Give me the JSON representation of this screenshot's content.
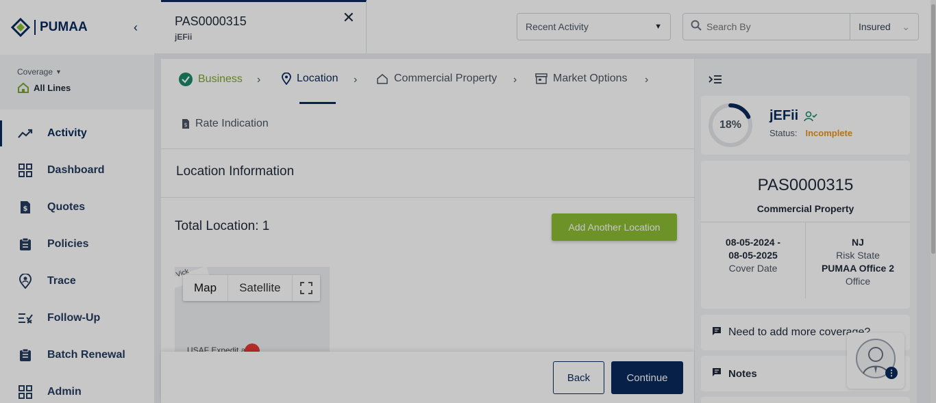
{
  "brand": {
    "name": "PUMAA"
  },
  "coverage": {
    "label": "Coverage",
    "value": "All Lines"
  },
  "nav": [
    {
      "label": "Activity",
      "icon": "trend-icon"
    },
    {
      "label": "Dashboard",
      "icon": "grid-icon"
    },
    {
      "label": "Quotes",
      "icon": "file-dollar-icon"
    },
    {
      "label": "Policies",
      "icon": "clipboard-icon"
    },
    {
      "label": "Trace",
      "icon": "location-person-icon"
    },
    {
      "label": "Follow-Up",
      "icon": "checklist-icon"
    },
    {
      "label": "Batch Renewal",
      "icon": "clipboard-list-icon"
    },
    {
      "label": "Admin",
      "icon": "grid-icon"
    }
  ],
  "tab": {
    "title": "PAS0000315",
    "subtitle": "jEFii"
  },
  "recent": {
    "label": "Recent Activity"
  },
  "search": {
    "placeholder": "Search By",
    "filter": "Insured"
  },
  "steps": {
    "business": "Business",
    "location": "Location",
    "commercial_property": "Commercial Property",
    "market_options": "Market Options",
    "rate_indication": "Rate Indication"
  },
  "main": {
    "section_title": "Location Information",
    "total_location": "Total Location: 1",
    "add_location": "Add Another Location"
  },
  "map": {
    "map_label": "Map",
    "satellite_label": "Satellite",
    "road_label": "Vick",
    "poi_label": "USAF Expedit        ary"
  },
  "footer": {
    "back": "Back",
    "continue": "Continue"
  },
  "status": {
    "name": "jEFii",
    "percent": "18%",
    "progress": 0.18,
    "status_label": "Status:",
    "status_value": "Incomplete"
  },
  "policy": {
    "number": "PAS0000315",
    "line": "Commercial Property",
    "date_line1": "08-05-2024 -",
    "date_line2": "08-05-2025",
    "date_label": "Cover Date",
    "state": "NJ",
    "state_label": "Risk State",
    "office": "PUMAA Office 2",
    "office_label": "Office"
  },
  "panel": {
    "coverage_prompt": "Need to add more coverage?",
    "notes": "Notes"
  },
  "colors": {
    "primary": "#0a2a5c",
    "accent_green": "#8cbc33",
    "status_orange": "#e4951e"
  }
}
